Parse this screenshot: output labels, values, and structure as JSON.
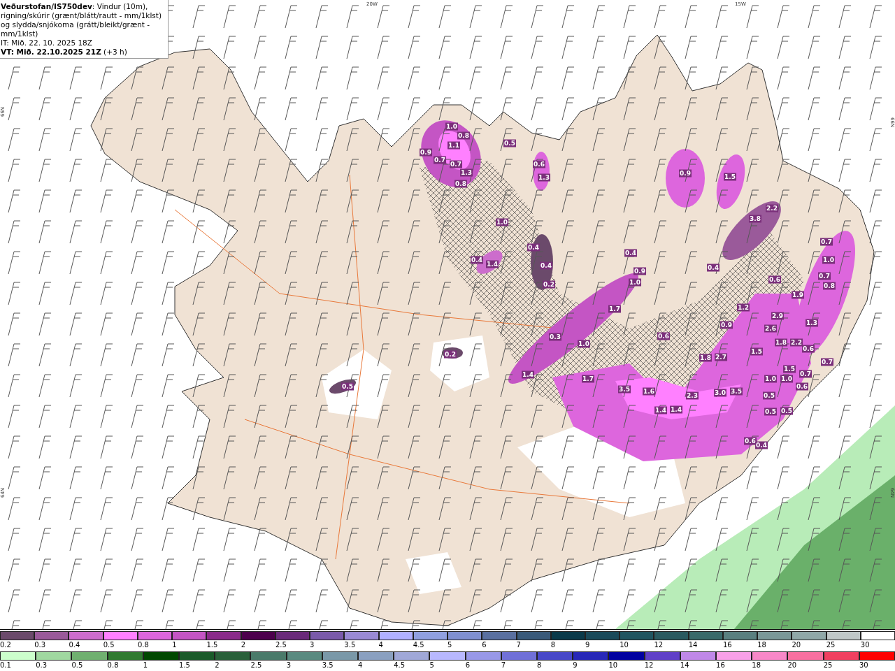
{
  "title_box": {
    "heading": "**Veðurstofan/IS750dev**: Vindur (10m), rigning/skúrir (grænt/blátt/rautt - mm/1klst) og slydda/snjókoma (grátt/bleikt/grænt - mm/1klst)",
    "issue_time": "IT: Mið. 22. 10. 2025 18Z",
    "valid_time": "**VT: Mið. 22.10.2025 21Z** (+3 h)"
  },
  "map": {
    "longitude_labels": [
      "20W",
      "15W"
    ],
    "latitude_labels": [
      "66N",
      "66N",
      "64N",
      "64N"
    ],
    "value_labels": [
      "1.0",
      "0.8",
      "0.9",
      "1.1",
      "0.7",
      "0.7",
      "1.3",
      "0.8",
      "0.5",
      "0.6",
      "1.3",
      "1.0",
      "0.4",
      "0.4",
      "0.4",
      "1.4",
      "0.2",
      "0.9",
      "1.5",
      "2.2",
      "3.8",
      "0.4",
      "0.9",
      "1.0",
      "0.4",
      "0.6",
      "0.7",
      "1.0",
      "0.7",
      "0.8",
      "1.9",
      "1.2",
      "1.7",
      "2.9",
      "0.9",
      "2.6",
      "1.3",
      "0.6",
      "0.3",
      "1.0",
      "1.8",
      "2.2",
      "0.6",
      "1.5",
      "1.8",
      "2.7",
      "0.7",
      "1.5",
      "1.4",
      "1.7",
      "1.0",
      "1.0",
      "0.7",
      "3.5",
      "1.6",
      "0.6",
      "2.3",
      "3.0",
      "3.5",
      "0.5",
      "1.4",
      "1.4",
      "0.5",
      "0.5",
      "0.6",
      "0.4",
      "0.5",
      "0.2"
    ]
  },
  "legend": {
    "upper_scale": [
      {
        "label": "0.2",
        "color": "#6b4a6b"
      },
      {
        "label": "0.3",
        "color": "#9a5a9a"
      },
      {
        "label": "0.4",
        "color": "#cc6dcc"
      },
      {
        "label": "0.5",
        "color": "#ff80ff"
      },
      {
        "label": "0.8",
        "color": "#dd66dd"
      },
      {
        "label": "1",
        "color": "#c455c4"
      },
      {
        "label": "1.5",
        "color": "#8a2a8a"
      },
      {
        "label": "2",
        "color": "#4d004d"
      },
      {
        "label": "2.5",
        "color": "#6a2a7a"
      },
      {
        "label": "3",
        "color": "#7a5aaa"
      },
      {
        "label": "3.5",
        "color": "#9a8ad4"
      },
      {
        "label": "4",
        "color": "#b0b0ff"
      },
      {
        "label": "4.5",
        "color": "#90a0e0"
      },
      {
        "label": "5",
        "color": "#8090d0"
      },
      {
        "label": "6",
        "color": "#5a70a0"
      },
      {
        "label": "7",
        "color": "#3a5a7a"
      },
      {
        "label": "8",
        "color": "#0a3a4a"
      },
      {
        "label": "9",
        "color": "#1a4a5a"
      },
      {
        "label": "10",
        "color": "#205560"
      },
      {
        "label": "12",
        "color": "#2a5a60"
      },
      {
        "label": "14",
        "color": "#3a6a6a"
      },
      {
        "label": "16",
        "color": "#5a8080"
      },
      {
        "label": "18",
        "color": "#7a9898"
      },
      {
        "label": "20",
        "color": "#90a8a8"
      },
      {
        "label": "25",
        "color": "#c0c8c8"
      },
      {
        "label": "30",
        "color": "#ffffff"
      }
    ],
    "lower_scale": [
      {
        "label": "0.1",
        "color": "#ccffcc"
      },
      {
        "label": "0.3",
        "color": "#a0d8a0"
      },
      {
        "label": "0.5",
        "color": "#70b070"
      },
      {
        "label": "0.8",
        "color": "#307a30"
      },
      {
        "label": "1",
        "color": "#004800"
      },
      {
        "label": "1.5",
        "color": "#1a5a2a"
      },
      {
        "label": "2",
        "color": "#2a603a"
      },
      {
        "label": "2.5",
        "color": "#4a7a6a"
      },
      {
        "label": "3",
        "color": "#5a8a80"
      },
      {
        "label": "3.5",
        "color": "#7a98a8"
      },
      {
        "label": "4",
        "color": "#8aa0c0"
      },
      {
        "label": "4.5",
        "color": "#a0a8d8"
      },
      {
        "label": "5",
        "color": "#b8b8ff"
      },
      {
        "label": "6",
        "color": "#9898e8"
      },
      {
        "label": "7",
        "color": "#7070d8"
      },
      {
        "label": "8",
        "color": "#4848c8"
      },
      {
        "label": "9",
        "color": "#2828b8"
      },
      {
        "label": "10",
        "color": "#0000a0"
      },
      {
        "label": "12",
        "color": "#6040c8"
      },
      {
        "label": "14",
        "color": "#c088e8"
      },
      {
        "label": "16",
        "color": "#f8a0e8"
      },
      {
        "label": "18",
        "color": "#f888c8"
      },
      {
        "label": "20",
        "color": "#f870a0"
      },
      {
        "label": "25",
        "color": "#f04060"
      },
      {
        "label": "30",
        "color": "#ff0000"
      }
    ]
  }
}
